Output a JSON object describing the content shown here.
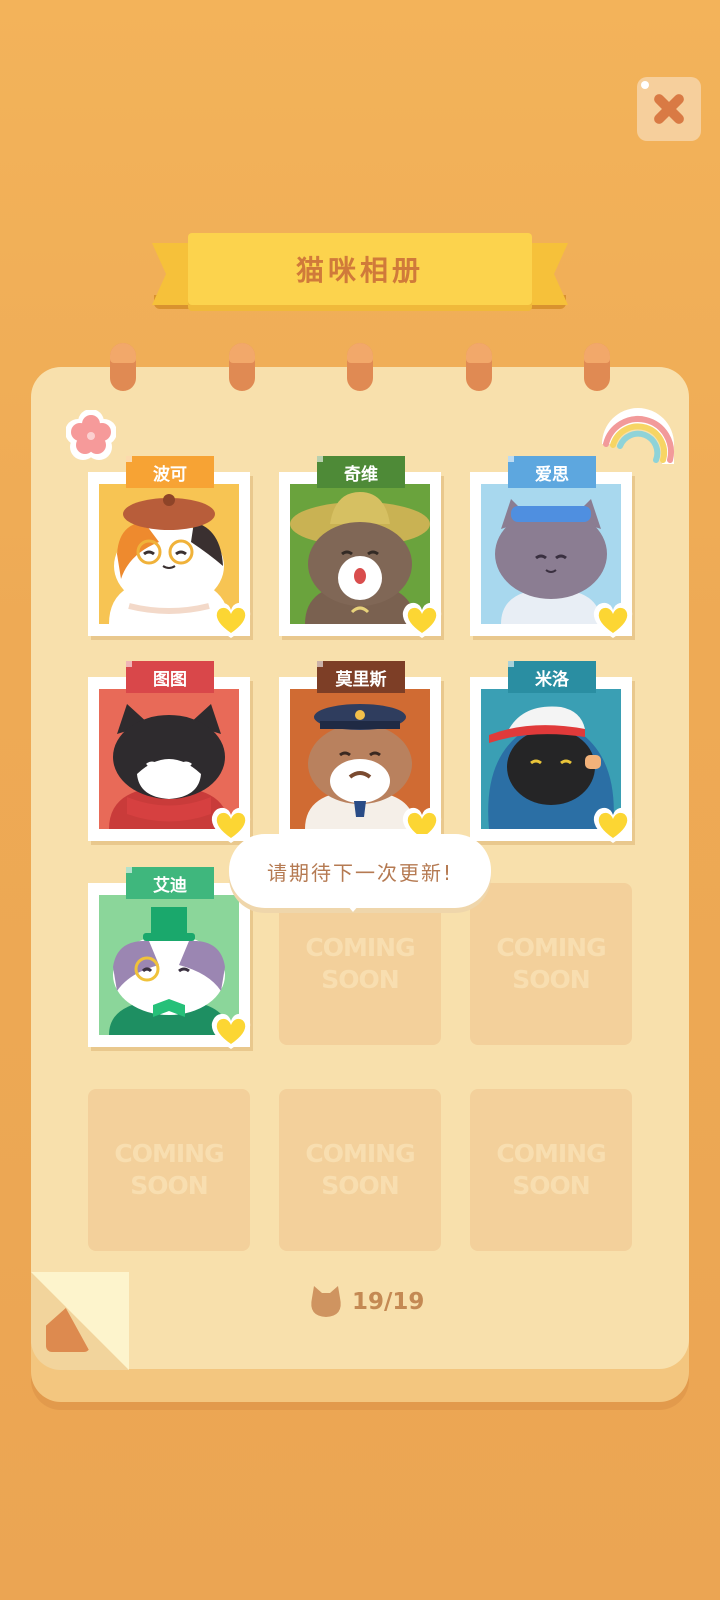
{
  "title": "猫咪相册",
  "cats": [
    {
      "name": "波可",
      "tag_color": "#f7a334",
      "bg": "#f7c453"
    },
    {
      "name": "奇维",
      "tag_color": "#4e8a37",
      "bg": "#6aa33d"
    },
    {
      "name": "爱思",
      "tag_color": "#5da7df",
      "bg": "#a8d8ee"
    },
    {
      "name": "图图",
      "tag_color": "#d9474a",
      "bg": "#e86a58"
    },
    {
      "name": "莫里斯",
      "tag_color": "#7d3e26",
      "bg": "#d06b33"
    },
    {
      "name": "米洛",
      "tag_color": "#2a8ea2",
      "bg": "#3a9fb4"
    },
    {
      "name": "艾迪",
      "tag_color": "#3fb77d",
      "bg": "#8bd69a"
    }
  ],
  "coming_soon": {
    "line1": "COMING",
    "line2": "SOON"
  },
  "bubble_text": "请期待下一次更新!",
  "counter": "19/19",
  "colors": {
    "heart": "#fcd633",
    "accent": "#d07a3a"
  }
}
